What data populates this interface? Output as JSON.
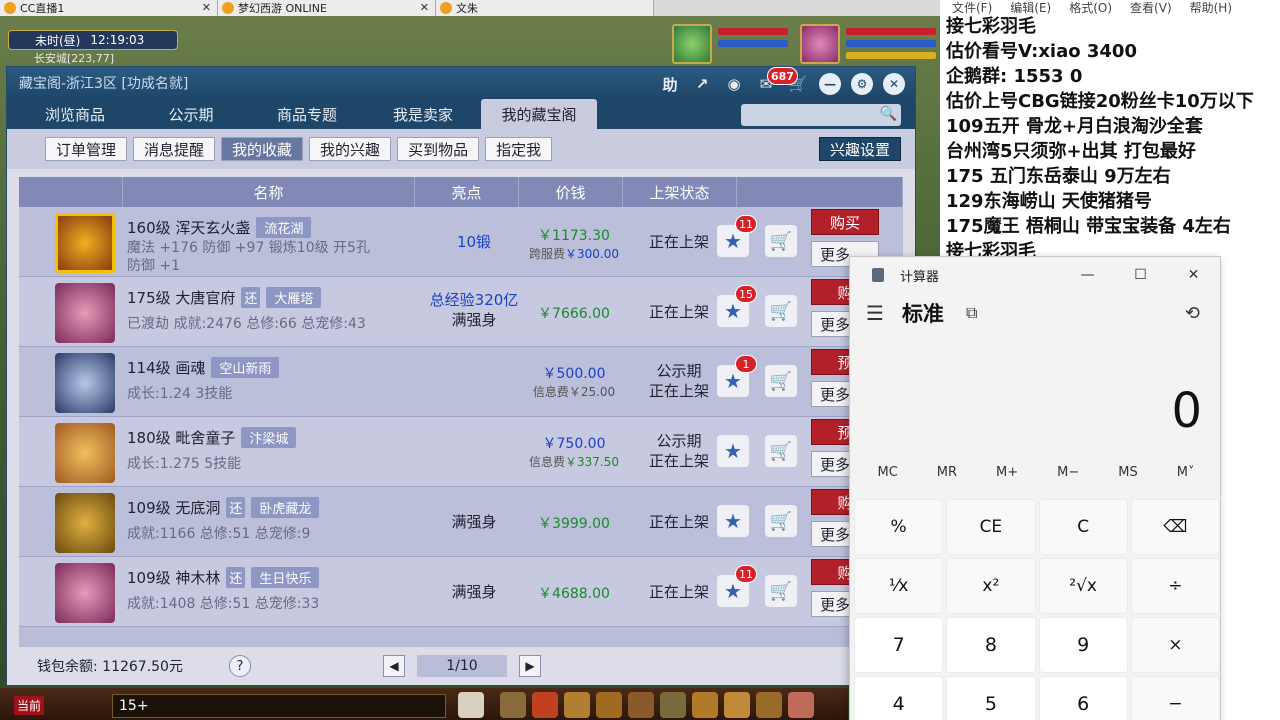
{
  "browser_tabs": [
    {
      "label": "CC直播1"
    },
    {
      "label": "梦幻西游 ONLINE"
    },
    {
      "label": "文朱"
    }
  ],
  "game_hud": {
    "time_label": "未时(昼)",
    "clock": "12:19:03",
    "location": "长安城[223,77]",
    "chat_input": "15+",
    "current_channel": "当前"
  },
  "store": {
    "title": "藏宝阁-浙江3区 [功成名就]",
    "help_label": "助",
    "message_badge": "687",
    "nav_tabs": [
      "浏览商品",
      "公示期",
      "商品专题",
      "我是卖家",
      "我的藏宝阁"
    ],
    "active_nav": 4,
    "sub_tabs": [
      "订单管理",
      "消息提醒",
      "我的收藏",
      "我的兴趣",
      "买到物品",
      "指定我"
    ],
    "active_sub": 2,
    "interest_settings": "兴趣设置",
    "columns": [
      "名称",
      "亮点",
      "价钱",
      "上架状态"
    ],
    "rows": [
      {
        "name": "160级 浑天玄火盏",
        "tag": "流花湖",
        "desc": "魔法 +176 防御 +97 锻炼10级 开5孔",
        "desc2": "防御 +1",
        "highlight": "10锻",
        "highlight2": "",
        "price": "￥1173.30",
        "fee_label": "跨服费",
        "fee": "￥300.00",
        "status": "正在上架",
        "status2": "",
        "fav_count": "11",
        "buy": "购买",
        "more": "更多"
      },
      {
        "name": "175级 大唐官府",
        "mark": "还",
        "tag": "大雁塔",
        "desc": "已渡劫 成就:2476 总修:66 总宠修:43",
        "highlight": "总经验320亿",
        "highlight2": "满强身",
        "price": "￥7666.00",
        "fee_label": "",
        "fee": "",
        "status": "正在上架",
        "status2": "",
        "fav_count": "15",
        "buy": "购",
        "more": "更多"
      },
      {
        "name": "114级 画魂",
        "tag": "空山新雨",
        "desc": "成长:1.24 3技能",
        "highlight": "",
        "highlight2": "",
        "price": "￥500.00",
        "fee_label": "信息费",
        "fee": "￥25.00",
        "status": "公示期",
        "status2": "正在上架",
        "fav_count": "1",
        "buy": "预",
        "more": "更多"
      },
      {
        "name": "180级 毗舍童子",
        "tag": "汴梁城",
        "desc": "成长:1.275 5技能",
        "highlight": "",
        "highlight2": "",
        "price": "￥750.00",
        "fee_label": "信息费",
        "fee": "￥337.50",
        "status": "公示期",
        "status2": "正在上架",
        "fav_count": "",
        "buy": "预",
        "more": "更多"
      },
      {
        "name": "109级 无底洞",
        "mark": "还",
        "tag": "卧虎藏龙",
        "desc": "成就:1166 总修:51 总宠修:9",
        "highlight": "满强身",
        "highlight2": "",
        "price": "￥3999.00",
        "fee_label": "",
        "fee": "",
        "status": "正在上架",
        "status2": "",
        "fav_count": "",
        "buy": "购",
        "more": "更多"
      },
      {
        "name": "109级 神木林",
        "mark": "还",
        "tag": "生日快乐",
        "desc": "成就:1408 总修:51 总宠修:33",
        "highlight": "满强身",
        "highlight2": "",
        "price": "￥4688.00",
        "fee_label": "",
        "fee": "",
        "status": "正在上架",
        "status2": "",
        "fav_count": "11",
        "buy": "购",
        "more": "更多"
      }
    ],
    "wallet": "钱包余额: 11267.50元",
    "help": "?",
    "page": "1/10"
  },
  "notepad": {
    "menu": [
      "文件(F)",
      "编辑(E)",
      "格式(O)",
      "查看(V)",
      "帮助(H)"
    ],
    "lines": [
      "  接七彩羽毛",
      "估价看号V:xiao  3400",
      "企鹅群: 1553  0",
      "估价上号CBG链接20粉丝卡10万以下",
      "109五开 骨龙+月白浪淘沙全套",
      "台州湾5只须弥+出其 打包最好",
      "175 五门东岳泰山  9万左右",
      "129东海崂山 天使猪猪号",
      "175魔王 梧桐山  带宝宝装备 4左右",
      "  接七彩羽毛"
    ]
  },
  "calculator": {
    "title": "计算器",
    "mode": "标准",
    "display": "0",
    "memory": [
      "MC",
      "MR",
      "M+",
      "M−",
      "MS",
      "M˅"
    ],
    "keys": [
      "%",
      "CE",
      "C",
      "⌫",
      "¹⁄x",
      "x²",
      "²√x",
      "÷",
      "7",
      "8",
      "9",
      "×",
      "4",
      "5",
      "6",
      "−"
    ]
  }
}
